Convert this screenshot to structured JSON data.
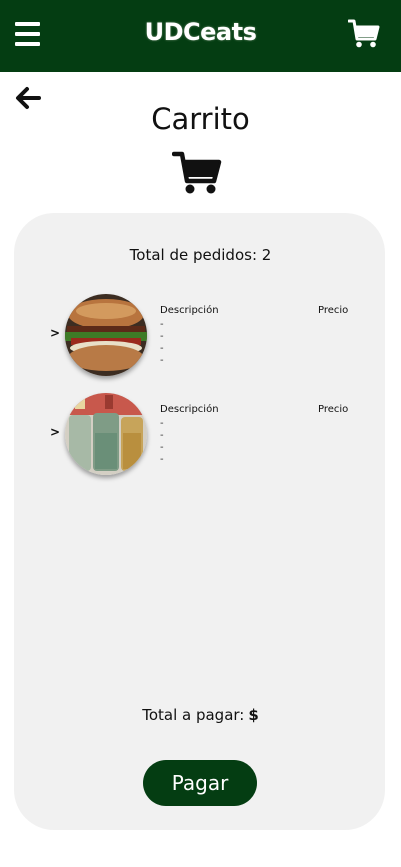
{
  "header": {
    "brand": "UDCeats",
    "menu_icon": "hamburger-menu-icon",
    "cart_icon": "shopping-cart-icon",
    "color": "#043d12"
  },
  "page": {
    "back_icon": "arrow-left-icon",
    "title": "Carrito",
    "title_icon": "shopping-cart-icon"
  },
  "orders": {
    "total_label": "Total de pedidos:",
    "total_count": "2",
    "items": [
      {
        "image": "sandwich-photo",
        "expand_icon": ">",
        "description_label": "Descripción",
        "price_label": "Precio",
        "lines": [
          "-",
          "-",
          "-",
          "-"
        ]
      },
      {
        "image": "drinks-photo",
        "expand_icon": ">",
        "description_label": "Descripción",
        "price_label": "Precio",
        "lines": [
          "-",
          "-",
          "-",
          "-"
        ]
      }
    ]
  },
  "payment": {
    "total_label": "Total a pagar:",
    "amount": "$",
    "button_label": "Pagar"
  }
}
